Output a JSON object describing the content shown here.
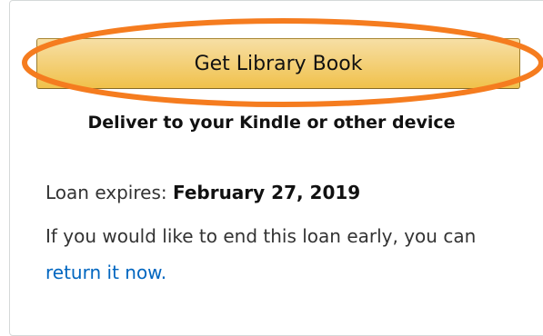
{
  "action": {
    "get_library_book_label": "Get Library Book",
    "deliver_text": "Deliver to your Kindle or other device"
  },
  "loan": {
    "expires_label": "Loan expires:",
    "expires_date": "February 27, 2019",
    "early_return_text_before": "If you would like to end this loan early, you can",
    "return_link_label": "return it now."
  },
  "colors": {
    "highlight_ring": "#f57c1f",
    "button_top": "#f7dfa5",
    "button_bottom": "#f0c14b",
    "link": "#0066c0"
  }
}
